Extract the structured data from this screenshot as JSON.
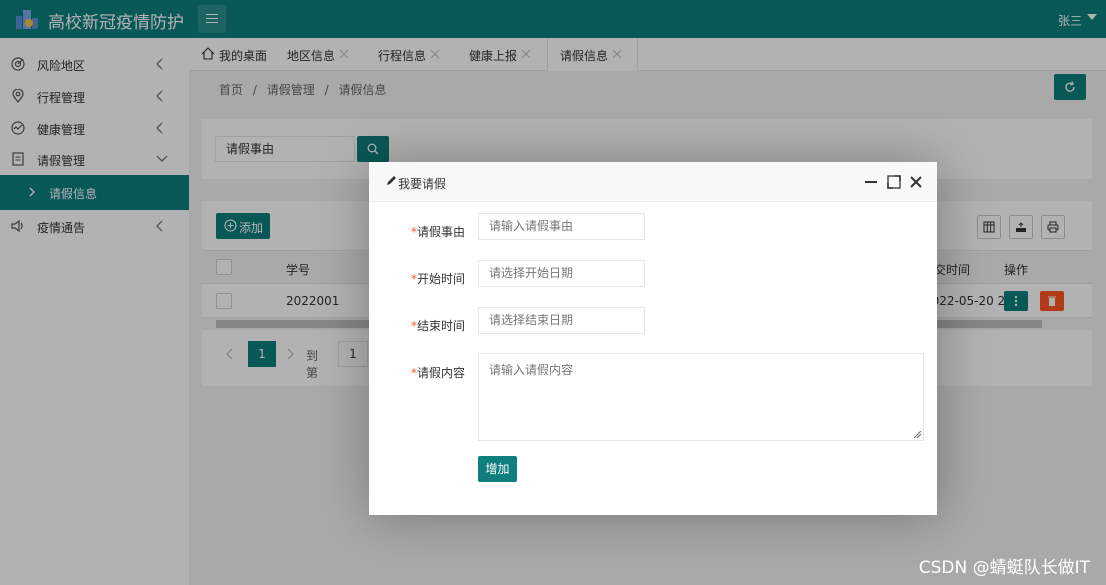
{
  "app": {
    "title": "高校新冠疫情防护",
    "user": "张三"
  },
  "sidebar": {
    "items": [
      {
        "label": "风险地区",
        "icon": "radar-icon"
      },
      {
        "label": "行程管理",
        "icon": "location-pin-icon"
      },
      {
        "label": "健康管理",
        "icon": "health-chart-icon"
      },
      {
        "label": "请假管理",
        "icon": "document-icon"
      },
      {
        "label": "疫情通告",
        "icon": "speaker-icon"
      }
    ],
    "sub_active": "请假信息"
  },
  "tabs": [
    {
      "label": "我的桌面"
    },
    {
      "label": "地区信息"
    },
    {
      "label": "行程信息"
    },
    {
      "label": "健康上报"
    },
    {
      "label": "请假信息"
    }
  ],
  "breadcrumb": [
    "首页",
    "/",
    "请假管理",
    "/",
    "请假信息"
  ],
  "search": {
    "value": "请假事由"
  },
  "table": {
    "add_label": "添加",
    "headers": {
      "id": "学号",
      "submit_time": "提交时间",
      "ops": "操作"
    },
    "rows": [
      {
        "id": "2022001",
        "submit_time": "2022-05-20 2"
      }
    ],
    "pager": {
      "page": "1",
      "goto_label": "到第",
      "goto_value": "1"
    }
  },
  "modal": {
    "title": "我要请假",
    "fields": [
      {
        "label": "请假事由",
        "placeholder": "请输入请假事由"
      },
      {
        "label": "开始时间",
        "placeholder": "请选择开始日期"
      },
      {
        "label": "结束时间",
        "placeholder": "请选择结束日期"
      },
      {
        "label": "请假内容",
        "placeholder": "请输入请假内容"
      }
    ],
    "required_mark": "*",
    "submit_label": "增加"
  },
  "watermark": "CSDN @蜻蜓队长做IT",
  "colors": {
    "primary": "#0e7e7f",
    "danger": "#ff5722"
  }
}
